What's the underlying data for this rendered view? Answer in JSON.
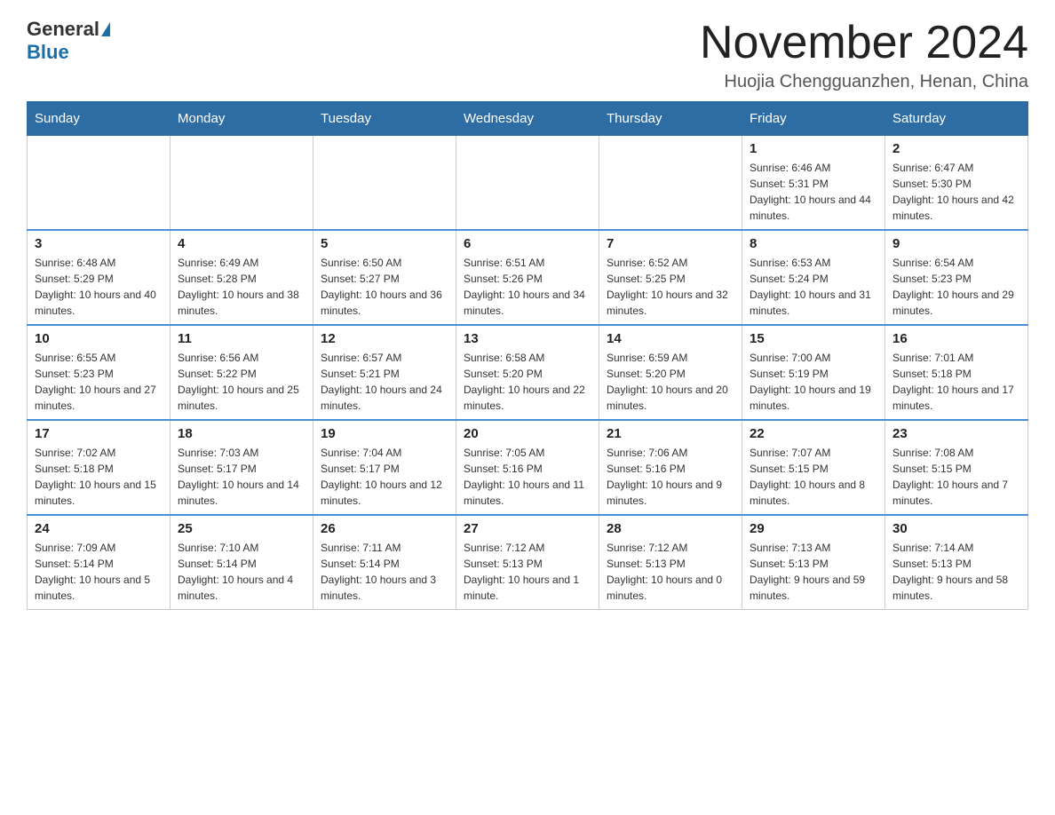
{
  "logo": {
    "general": "General",
    "blue": "Blue"
  },
  "title": "November 2024",
  "location": "Huojia Chengguanzhen, Henan, China",
  "weekdays": [
    "Sunday",
    "Monday",
    "Tuesday",
    "Wednesday",
    "Thursday",
    "Friday",
    "Saturday"
  ],
  "weeks": [
    [
      {
        "day": "",
        "info": ""
      },
      {
        "day": "",
        "info": ""
      },
      {
        "day": "",
        "info": ""
      },
      {
        "day": "",
        "info": ""
      },
      {
        "day": "",
        "info": ""
      },
      {
        "day": "1",
        "info": "Sunrise: 6:46 AM\nSunset: 5:31 PM\nDaylight: 10 hours and 44 minutes."
      },
      {
        "day": "2",
        "info": "Sunrise: 6:47 AM\nSunset: 5:30 PM\nDaylight: 10 hours and 42 minutes."
      }
    ],
    [
      {
        "day": "3",
        "info": "Sunrise: 6:48 AM\nSunset: 5:29 PM\nDaylight: 10 hours and 40 minutes."
      },
      {
        "day": "4",
        "info": "Sunrise: 6:49 AM\nSunset: 5:28 PM\nDaylight: 10 hours and 38 minutes."
      },
      {
        "day": "5",
        "info": "Sunrise: 6:50 AM\nSunset: 5:27 PM\nDaylight: 10 hours and 36 minutes."
      },
      {
        "day": "6",
        "info": "Sunrise: 6:51 AM\nSunset: 5:26 PM\nDaylight: 10 hours and 34 minutes."
      },
      {
        "day": "7",
        "info": "Sunrise: 6:52 AM\nSunset: 5:25 PM\nDaylight: 10 hours and 32 minutes."
      },
      {
        "day": "8",
        "info": "Sunrise: 6:53 AM\nSunset: 5:24 PM\nDaylight: 10 hours and 31 minutes."
      },
      {
        "day": "9",
        "info": "Sunrise: 6:54 AM\nSunset: 5:23 PM\nDaylight: 10 hours and 29 minutes."
      }
    ],
    [
      {
        "day": "10",
        "info": "Sunrise: 6:55 AM\nSunset: 5:23 PM\nDaylight: 10 hours and 27 minutes."
      },
      {
        "day": "11",
        "info": "Sunrise: 6:56 AM\nSunset: 5:22 PM\nDaylight: 10 hours and 25 minutes."
      },
      {
        "day": "12",
        "info": "Sunrise: 6:57 AM\nSunset: 5:21 PM\nDaylight: 10 hours and 24 minutes."
      },
      {
        "day": "13",
        "info": "Sunrise: 6:58 AM\nSunset: 5:20 PM\nDaylight: 10 hours and 22 minutes."
      },
      {
        "day": "14",
        "info": "Sunrise: 6:59 AM\nSunset: 5:20 PM\nDaylight: 10 hours and 20 minutes."
      },
      {
        "day": "15",
        "info": "Sunrise: 7:00 AM\nSunset: 5:19 PM\nDaylight: 10 hours and 19 minutes."
      },
      {
        "day": "16",
        "info": "Sunrise: 7:01 AM\nSunset: 5:18 PM\nDaylight: 10 hours and 17 minutes."
      }
    ],
    [
      {
        "day": "17",
        "info": "Sunrise: 7:02 AM\nSunset: 5:18 PM\nDaylight: 10 hours and 15 minutes."
      },
      {
        "day": "18",
        "info": "Sunrise: 7:03 AM\nSunset: 5:17 PM\nDaylight: 10 hours and 14 minutes."
      },
      {
        "day": "19",
        "info": "Sunrise: 7:04 AM\nSunset: 5:17 PM\nDaylight: 10 hours and 12 minutes."
      },
      {
        "day": "20",
        "info": "Sunrise: 7:05 AM\nSunset: 5:16 PM\nDaylight: 10 hours and 11 minutes."
      },
      {
        "day": "21",
        "info": "Sunrise: 7:06 AM\nSunset: 5:16 PM\nDaylight: 10 hours and 9 minutes."
      },
      {
        "day": "22",
        "info": "Sunrise: 7:07 AM\nSunset: 5:15 PM\nDaylight: 10 hours and 8 minutes."
      },
      {
        "day": "23",
        "info": "Sunrise: 7:08 AM\nSunset: 5:15 PM\nDaylight: 10 hours and 7 minutes."
      }
    ],
    [
      {
        "day": "24",
        "info": "Sunrise: 7:09 AM\nSunset: 5:14 PM\nDaylight: 10 hours and 5 minutes."
      },
      {
        "day": "25",
        "info": "Sunrise: 7:10 AM\nSunset: 5:14 PM\nDaylight: 10 hours and 4 minutes."
      },
      {
        "day": "26",
        "info": "Sunrise: 7:11 AM\nSunset: 5:14 PM\nDaylight: 10 hours and 3 minutes."
      },
      {
        "day": "27",
        "info": "Sunrise: 7:12 AM\nSunset: 5:13 PM\nDaylight: 10 hours and 1 minute."
      },
      {
        "day": "28",
        "info": "Sunrise: 7:12 AM\nSunset: 5:13 PM\nDaylight: 10 hours and 0 minutes."
      },
      {
        "day": "29",
        "info": "Sunrise: 7:13 AM\nSunset: 5:13 PM\nDaylight: 9 hours and 59 minutes."
      },
      {
        "day": "30",
        "info": "Sunrise: 7:14 AM\nSunset: 5:13 PM\nDaylight: 9 hours and 58 minutes."
      }
    ]
  ]
}
